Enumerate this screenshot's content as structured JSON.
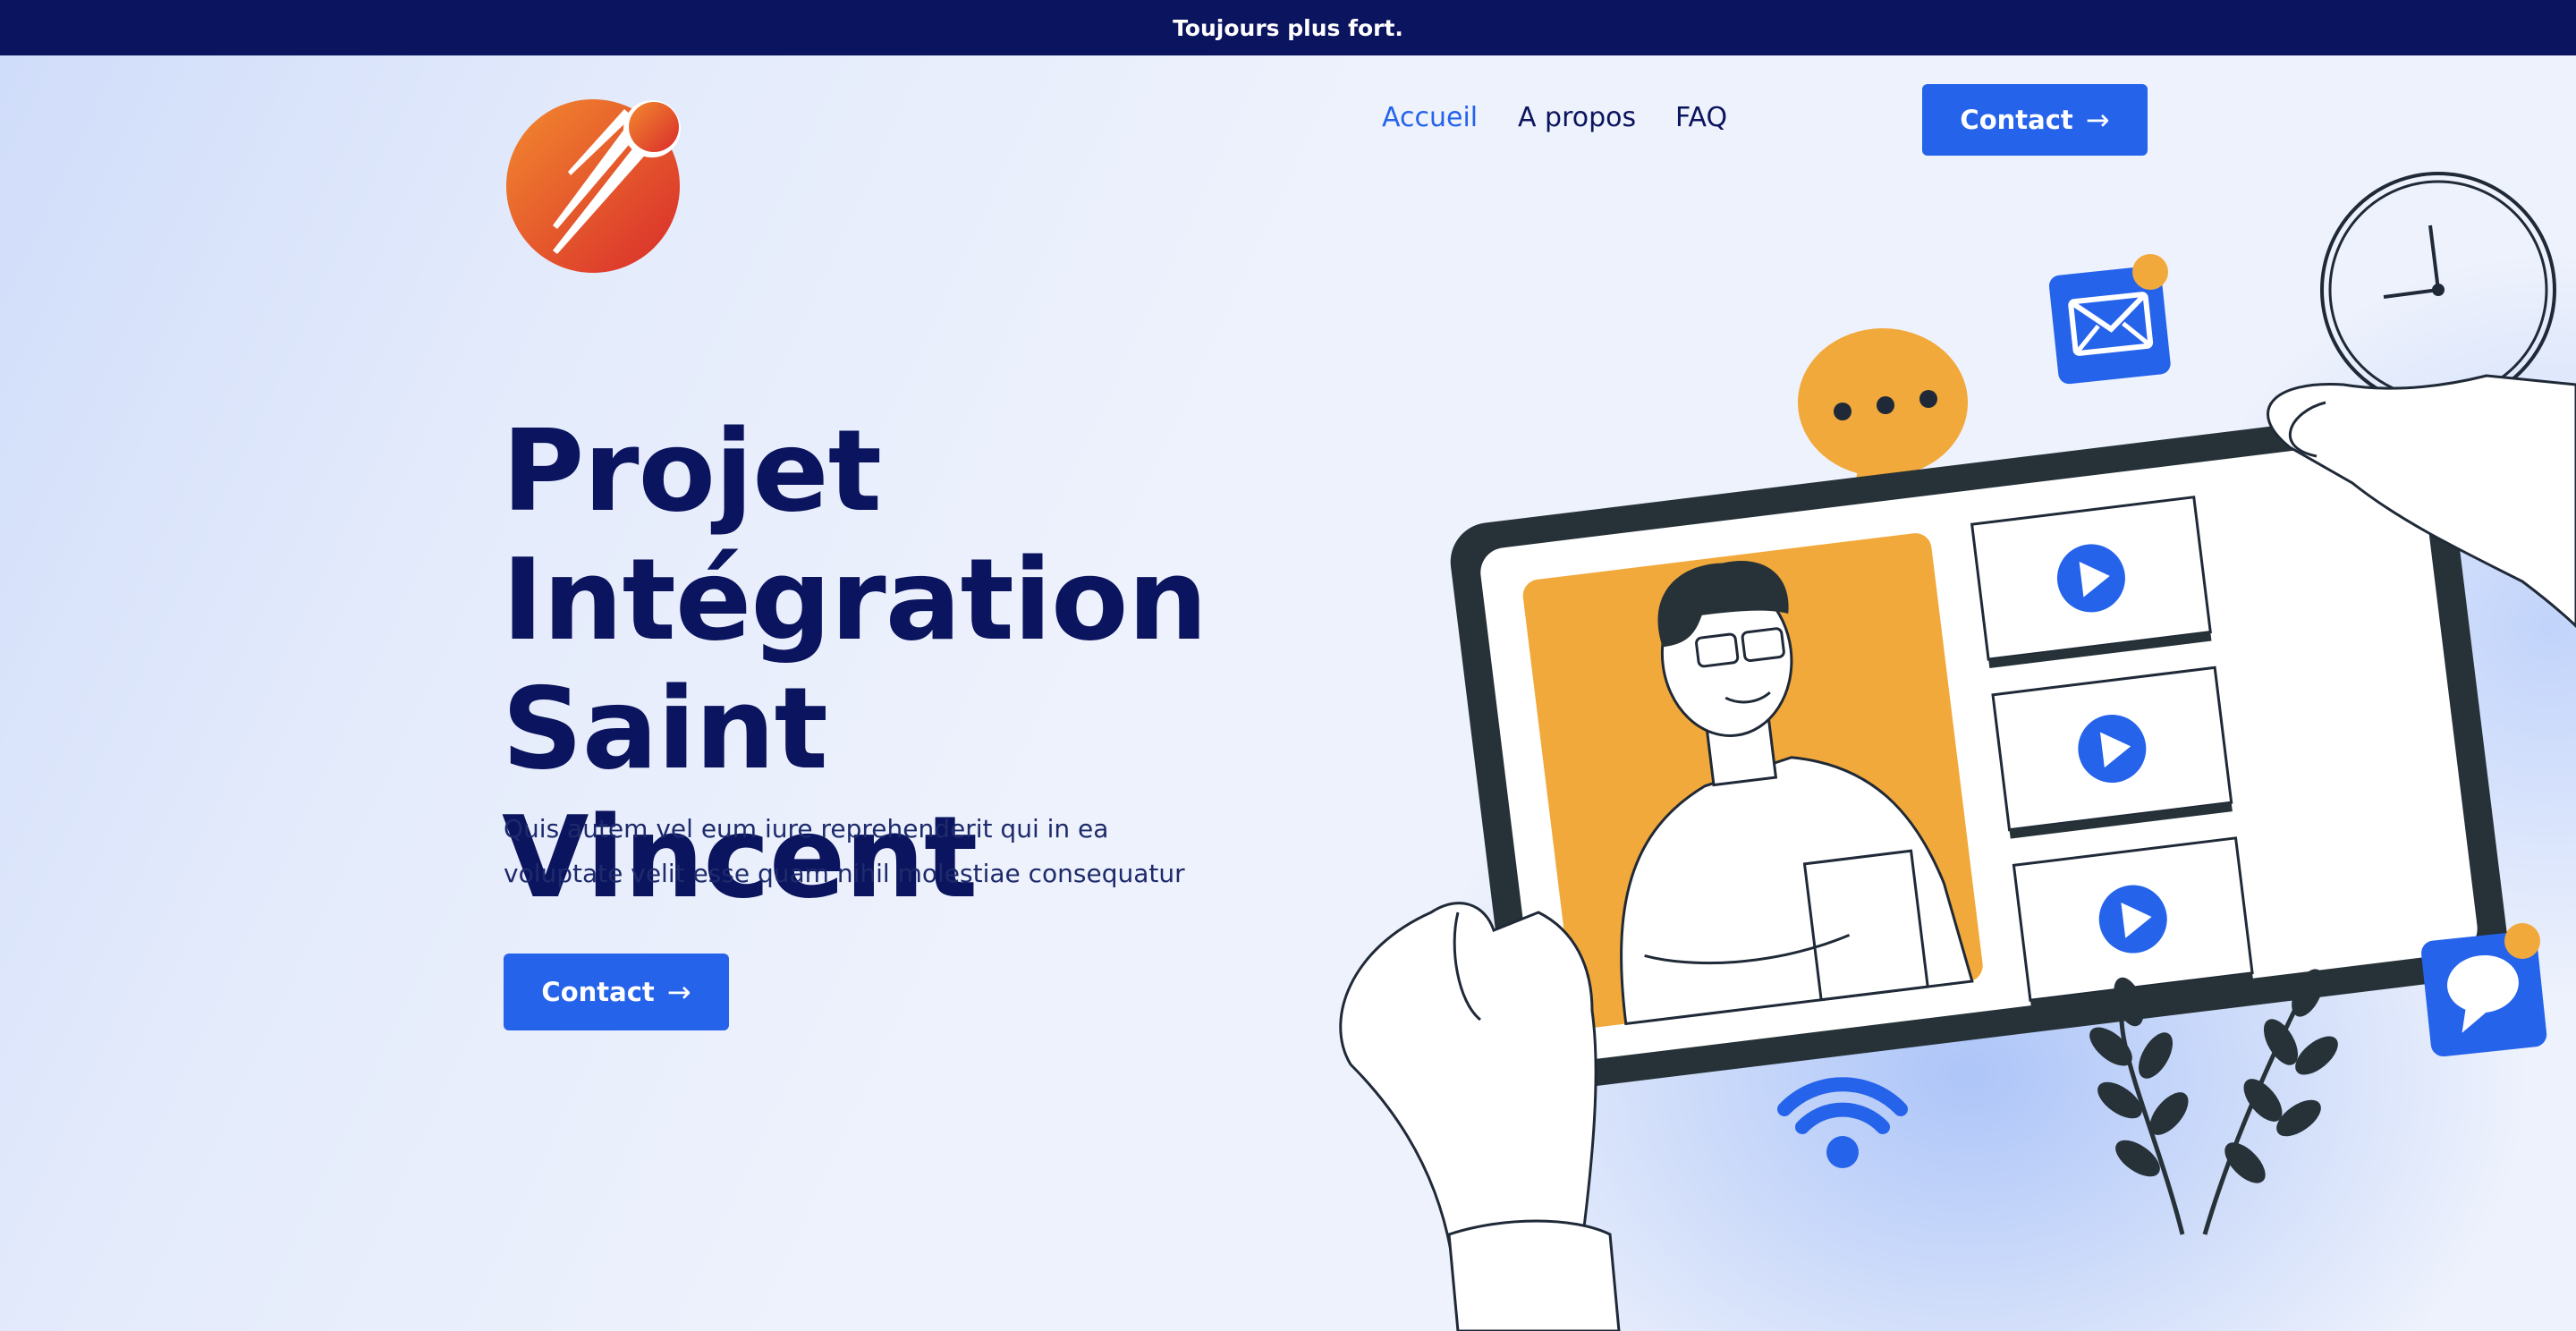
{
  "topbar": {
    "text": "Toujours plus fort."
  },
  "nav": {
    "items": [
      {
        "label": "Accueil",
        "active": true
      },
      {
        "label": "A propos",
        "active": false
      },
      {
        "label": "FAQ",
        "active": false
      }
    ],
    "cta_label": "Contact"
  },
  "hero": {
    "title_lines": [
      "Projet",
      "Intégration",
      "Saint Vincent"
    ],
    "subtitle": "Quis autem vel eum iure reprehenderit qui in ea voluptate velit esse quam nihil molestiae consequatur",
    "cta_label": "Contact"
  },
  "icons": {
    "logo": "comet-logo",
    "button_arrow": "arrow-right-icon",
    "illustration": [
      "clock-icon",
      "mail-icon",
      "chat-bubble-icon",
      "wifi-icon",
      "play-icon",
      "plant-icon"
    ]
  },
  "colors": {
    "navy": "#0b145e",
    "accent": "#2563eb",
    "orange": "#f2a93b",
    "logo_gradient": [
      "#f28a2e",
      "#d92b2b"
    ]
  }
}
